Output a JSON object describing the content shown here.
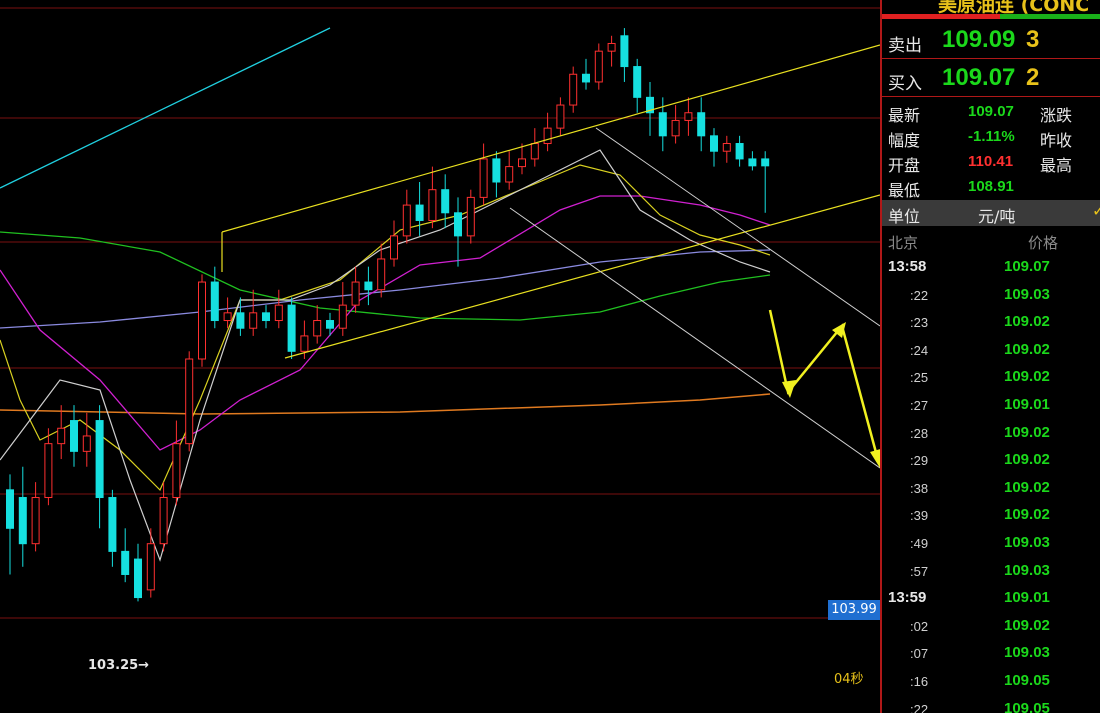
{
  "top_links": [
    "",
    "",
    ""
  ],
  "low_marker": "103.25→",
  "last_price_tag": "103.99",
  "countdown": "04秒",
  "panel": {
    "title": "美原油连 (CONC",
    "sell": {
      "label": "卖出",
      "price": "109.09",
      "volume": "3"
    },
    "buy": {
      "label": "买入",
      "price": "109.07",
      "volume": "2"
    },
    "stats": [
      {
        "label": "最新",
        "value": "109.07",
        "color": "#1bd81b",
        "label2": "涨跌"
      },
      {
        "label": "幅度",
        "value": "-1.11%",
        "color": "#1bd81b",
        "label2": "昨收"
      },
      {
        "label": "开盘",
        "value": "110.41",
        "color": "#ff3030",
        "label2": "最高"
      },
      {
        "label": "最低",
        "value": "108.91",
        "color": "#1bd81b",
        "label2": ""
      }
    ],
    "unit_label": "单位",
    "unit_value": "元/吨",
    "unit_arrow": "✓",
    "header_time": "北京",
    "header_price": "价格",
    "ticks": [
      {
        "time": "13:58",
        "price": "109.07",
        "big": true
      },
      {
        "time": ":22",
        "price": "109.03"
      },
      {
        "time": ":23",
        "price": "109.02"
      },
      {
        "time": ":24",
        "price": "109.02"
      },
      {
        "time": ":25",
        "price": "109.02"
      },
      {
        "time": ":27",
        "price": "109.01"
      },
      {
        "time": ":28",
        "price": "109.02"
      },
      {
        "time": ":29",
        "price": "109.02"
      },
      {
        "time": ":38",
        "price": "109.02"
      },
      {
        "time": ":39",
        "price": "109.02"
      },
      {
        "time": ":49",
        "price": "109.03"
      },
      {
        "time": ":57",
        "price": "109.03"
      },
      {
        "time": "13:59",
        "price": "109.01",
        "big": true
      },
      {
        "time": ":02",
        "price": "109.02"
      },
      {
        "time": ":07",
        "price": "109.03"
      },
      {
        "time": ":16",
        "price": "109.05"
      },
      {
        "time": ":22",
        "price": "109.05"
      }
    ]
  },
  "colors": {
    "up": "#ff3030",
    "down": "#16e0e0",
    "grid": "#7a1010"
  },
  "chart_data": {
    "type": "candlestick",
    "candles": [
      {
        "o": 104.7,
        "c": 104.2,
        "h": 104.9,
        "l": 103.6
      },
      {
        "o": 104.6,
        "c": 104.0,
        "h": 105.0,
        "l": 103.7
      },
      {
        "o": 104.0,
        "c": 104.6,
        "h": 104.8,
        "l": 103.9
      },
      {
        "o": 104.6,
        "c": 105.3,
        "h": 105.5,
        "l": 104.5
      },
      {
        "o": 105.3,
        "c": 105.5,
        "h": 105.8,
        "l": 105.1
      },
      {
        "o": 105.6,
        "c": 105.2,
        "h": 105.8,
        "l": 105.0
      },
      {
        "o": 105.2,
        "c": 105.4,
        "h": 105.7,
        "l": 105.0
      },
      {
        "o": 105.6,
        "c": 104.6,
        "h": 105.8,
        "l": 104.2
      },
      {
        "o": 104.6,
        "c": 103.9,
        "h": 104.7,
        "l": 103.7
      },
      {
        "o": 103.9,
        "c": 103.6,
        "h": 104.2,
        "l": 103.5
      },
      {
        "o": 103.8,
        "c": 103.3,
        "h": 104.0,
        "l": 103.25
      },
      {
        "o": 103.4,
        "c": 104.0,
        "h": 104.2,
        "l": 103.3
      },
      {
        "o": 104.0,
        "c": 104.6,
        "h": 104.8,
        "l": 103.9
      },
      {
        "o": 104.6,
        "c": 105.3,
        "h": 105.6,
        "l": 104.5
      },
      {
        "o": 105.3,
        "c": 106.4,
        "h": 106.5,
        "l": 105.2
      },
      {
        "o": 106.4,
        "c": 107.4,
        "h": 107.5,
        "l": 106.3
      },
      {
        "o": 107.4,
        "c": 106.9,
        "h": 107.6,
        "l": 106.8
      },
      {
        "o": 106.9,
        "c": 107.0,
        "h": 107.2,
        "l": 106.8
      },
      {
        "o": 107.0,
        "c": 106.8,
        "h": 107.2,
        "l": 106.7
      },
      {
        "o": 106.8,
        "c": 107.0,
        "h": 107.3,
        "l": 106.7
      },
      {
        "o": 107.0,
        "c": 106.9,
        "h": 107.1,
        "l": 106.8
      },
      {
        "o": 106.9,
        "c": 107.1,
        "h": 107.3,
        "l": 106.8
      },
      {
        "o": 107.1,
        "c": 106.5,
        "h": 107.2,
        "l": 106.4
      },
      {
        "o": 106.5,
        "c": 106.7,
        "h": 106.9,
        "l": 106.4
      },
      {
        "o": 106.7,
        "c": 106.9,
        "h": 107.1,
        "l": 106.6
      },
      {
        "o": 106.9,
        "c": 106.8,
        "h": 107.0,
        "l": 106.7
      },
      {
        "o": 106.8,
        "c": 107.1,
        "h": 107.4,
        "l": 106.7
      },
      {
        "o": 107.1,
        "c": 107.4,
        "h": 107.6,
        "l": 107.0
      },
      {
        "o": 107.4,
        "c": 107.3,
        "h": 107.6,
        "l": 107.1
      },
      {
        "o": 107.3,
        "c": 107.7,
        "h": 107.9,
        "l": 107.2
      },
      {
        "o": 107.7,
        "c": 108.0,
        "h": 108.2,
        "l": 107.6
      },
      {
        "o": 108.0,
        "c": 108.4,
        "h": 108.6,
        "l": 107.9
      },
      {
        "o": 108.4,
        "c": 108.2,
        "h": 108.7,
        "l": 108.0
      },
      {
        "o": 108.2,
        "c": 108.6,
        "h": 108.9,
        "l": 108.1
      },
      {
        "o": 108.6,
        "c": 108.3,
        "h": 108.8,
        "l": 108.1
      },
      {
        "o": 108.3,
        "c": 108.0,
        "h": 108.5,
        "l": 107.6
      },
      {
        "o": 108.0,
        "c": 108.5,
        "h": 108.6,
        "l": 107.9
      },
      {
        "o": 108.5,
        "c": 109.0,
        "h": 109.2,
        "l": 108.4
      },
      {
        "o": 109.0,
        "c": 108.7,
        "h": 109.1,
        "l": 108.5
      },
      {
        "o": 108.7,
        "c": 108.9,
        "h": 109.1,
        "l": 108.6
      },
      {
        "o": 108.9,
        "c": 109.0,
        "h": 109.2,
        "l": 108.8
      },
      {
        "o": 109.0,
        "c": 109.2,
        "h": 109.4,
        "l": 108.9
      },
      {
        "o": 109.2,
        "c": 109.4,
        "h": 109.6,
        "l": 109.1
      },
      {
        "o": 109.4,
        "c": 109.7,
        "h": 109.8,
        "l": 109.3
      },
      {
        "o": 109.7,
        "c": 110.1,
        "h": 110.2,
        "l": 109.6
      },
      {
        "o": 110.1,
        "c": 110.0,
        "h": 110.3,
        "l": 109.9
      },
      {
        "o": 110.0,
        "c": 110.4,
        "h": 110.5,
        "l": 109.9
      },
      {
        "o": 110.4,
        "c": 110.5,
        "h": 110.6,
        "l": 110.2
      },
      {
        "o": 110.6,
        "c": 110.2,
        "h": 110.7,
        "l": 110.0
      },
      {
        "o": 110.2,
        "c": 109.8,
        "h": 110.3,
        "l": 109.6
      },
      {
        "o": 109.8,
        "c": 109.6,
        "h": 110.0,
        "l": 109.3
      },
      {
        "o": 109.6,
        "c": 109.3,
        "h": 109.8,
        "l": 109.1
      },
      {
        "o": 109.3,
        "c": 109.5,
        "h": 109.7,
        "l": 109.2
      },
      {
        "o": 109.5,
        "c": 109.6,
        "h": 109.8,
        "l": 109.3
      },
      {
        "o": 109.6,
        "c": 109.3,
        "h": 109.8,
        "l": 109.1
      },
      {
        "o": 109.3,
        "c": 109.1,
        "h": 109.4,
        "l": 108.9
      },
      {
        "o": 109.1,
        "c": 109.2,
        "h": 109.3,
        "l": 108.95
      },
      {
        "o": 109.2,
        "c": 109.0,
        "h": 109.3,
        "l": 108.9
      },
      {
        "o": 109.0,
        "c": 108.91,
        "h": 109.1,
        "l": 108.85
      },
      {
        "o": 109.0,
        "c": 108.91,
        "h": 109.1,
        "l": 108.3
      }
    ]
  }
}
